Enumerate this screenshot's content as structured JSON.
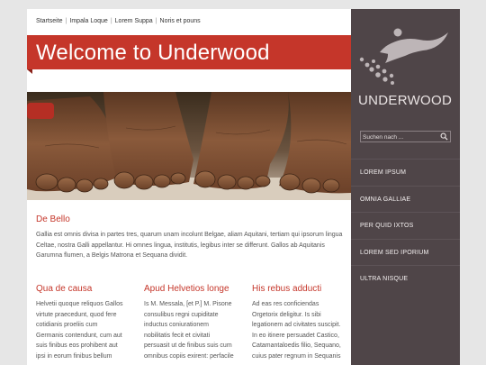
{
  "breadcrumb": {
    "items": [
      "Startseite",
      "Impala Loque",
      "Lorem Suppa",
      "Noris et pouns"
    ],
    "separator": "|"
  },
  "header": {
    "title": "Welcome to Underwood"
  },
  "colors": {
    "accent": "#c5362a",
    "sidebar": "#4f4548",
    "background": "#e6e6e6"
  },
  "intro": {
    "title": "De Bello",
    "lines": [
      "Gallia est omnis divisa in partes tres, quarum unam incolunt Belgae, aliam Aquitani, tertiam qui ipsorum lingua",
      "Celtae, nostra Galli appellantur. Hi omnes lingua, institutis, legibus inter se differunt. Gallos ab Aquitanis",
      "Garumna flumen, a Belgis Matrona et Sequana dividit."
    ]
  },
  "columns": [
    {
      "title": "Qua de causa",
      "lines": [
        "Helvetii quoque reliquos Gallos",
        "virtute praecedunt, quod fere",
        "cotidianis proeliis cum",
        "Germanis contendunt, cum aut",
        "suis finibus eos prohibent aut",
        "ipsi in eorum finibus bellum"
      ]
    },
    {
      "title": "Apud Helvetios longe",
      "lines": [
        "Is M. Messala, [et P.] M. Pisone",
        "consulibus regni cupiditate",
        "inductus coniurationem",
        "nobilitatis fecit et civitati",
        "persuasit ut de finibus suis cum",
        "omnibus copiis exirent: perfacile"
      ]
    },
    {
      "title": "His rebus adducti",
      "lines": [
        "Ad eas res conficiendas",
        "Orgetorix deligitur. Is sibi",
        "legationem ad civitates suscipit.",
        "In eo itinere persuadet Castico,",
        "Catamantaloedis filio, Sequano,",
        "cuius pater regnum in Sequanis"
      ]
    }
  ],
  "sidebar": {
    "logo_text": "UNDERWOOD",
    "logo_icon": "swimmer-icon",
    "search": {
      "placeholder": "Suchen nach ...",
      "value": "",
      "icon": "search-icon"
    },
    "nav": [
      "LOREM IPSUM",
      "OMNIA GALLIAE",
      "PER QUID IXTOS",
      "LOREM SED IPORIUM",
      "ULTRA NISQUE"
    ]
  }
}
